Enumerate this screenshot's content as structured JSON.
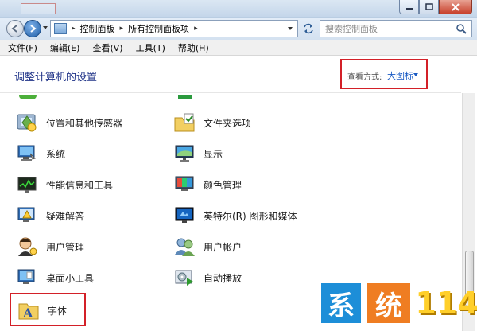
{
  "nav": {
    "breadcrumbs": [
      "控制面板",
      "所有控制面板项"
    ],
    "search_placeholder": "搜索控制面板"
  },
  "menu": [
    "文件(F)",
    "编辑(E)",
    "查看(V)",
    "工具(T)",
    "帮助(H)"
  ],
  "header": {
    "title": "调整计算机的设置",
    "view_by_label": "查看方式:",
    "view_by_value": "大图标"
  },
  "items": {
    "location_sensors": "位置和其他传感器",
    "folder_options": "文件夹选项",
    "system": "系统",
    "display": "显示",
    "performance": "性能信息和工具",
    "color_management": "颜色管理",
    "troubleshooting": "疑难解答",
    "intel_graphics": "英特尔(R) 图形和媒体",
    "user_management": "用户管理",
    "user_accounts": "用户帐户",
    "desktop_gadgets": "桌面小工具",
    "autoplay": "自动播放",
    "fonts": "字体"
  },
  "watermark": {
    "char1": "系",
    "char2": "统",
    "number": "114"
  },
  "colors": {
    "highlight_box": "#d32028",
    "title_text": "#1e3287",
    "link_blue": "#1a5bc4"
  }
}
